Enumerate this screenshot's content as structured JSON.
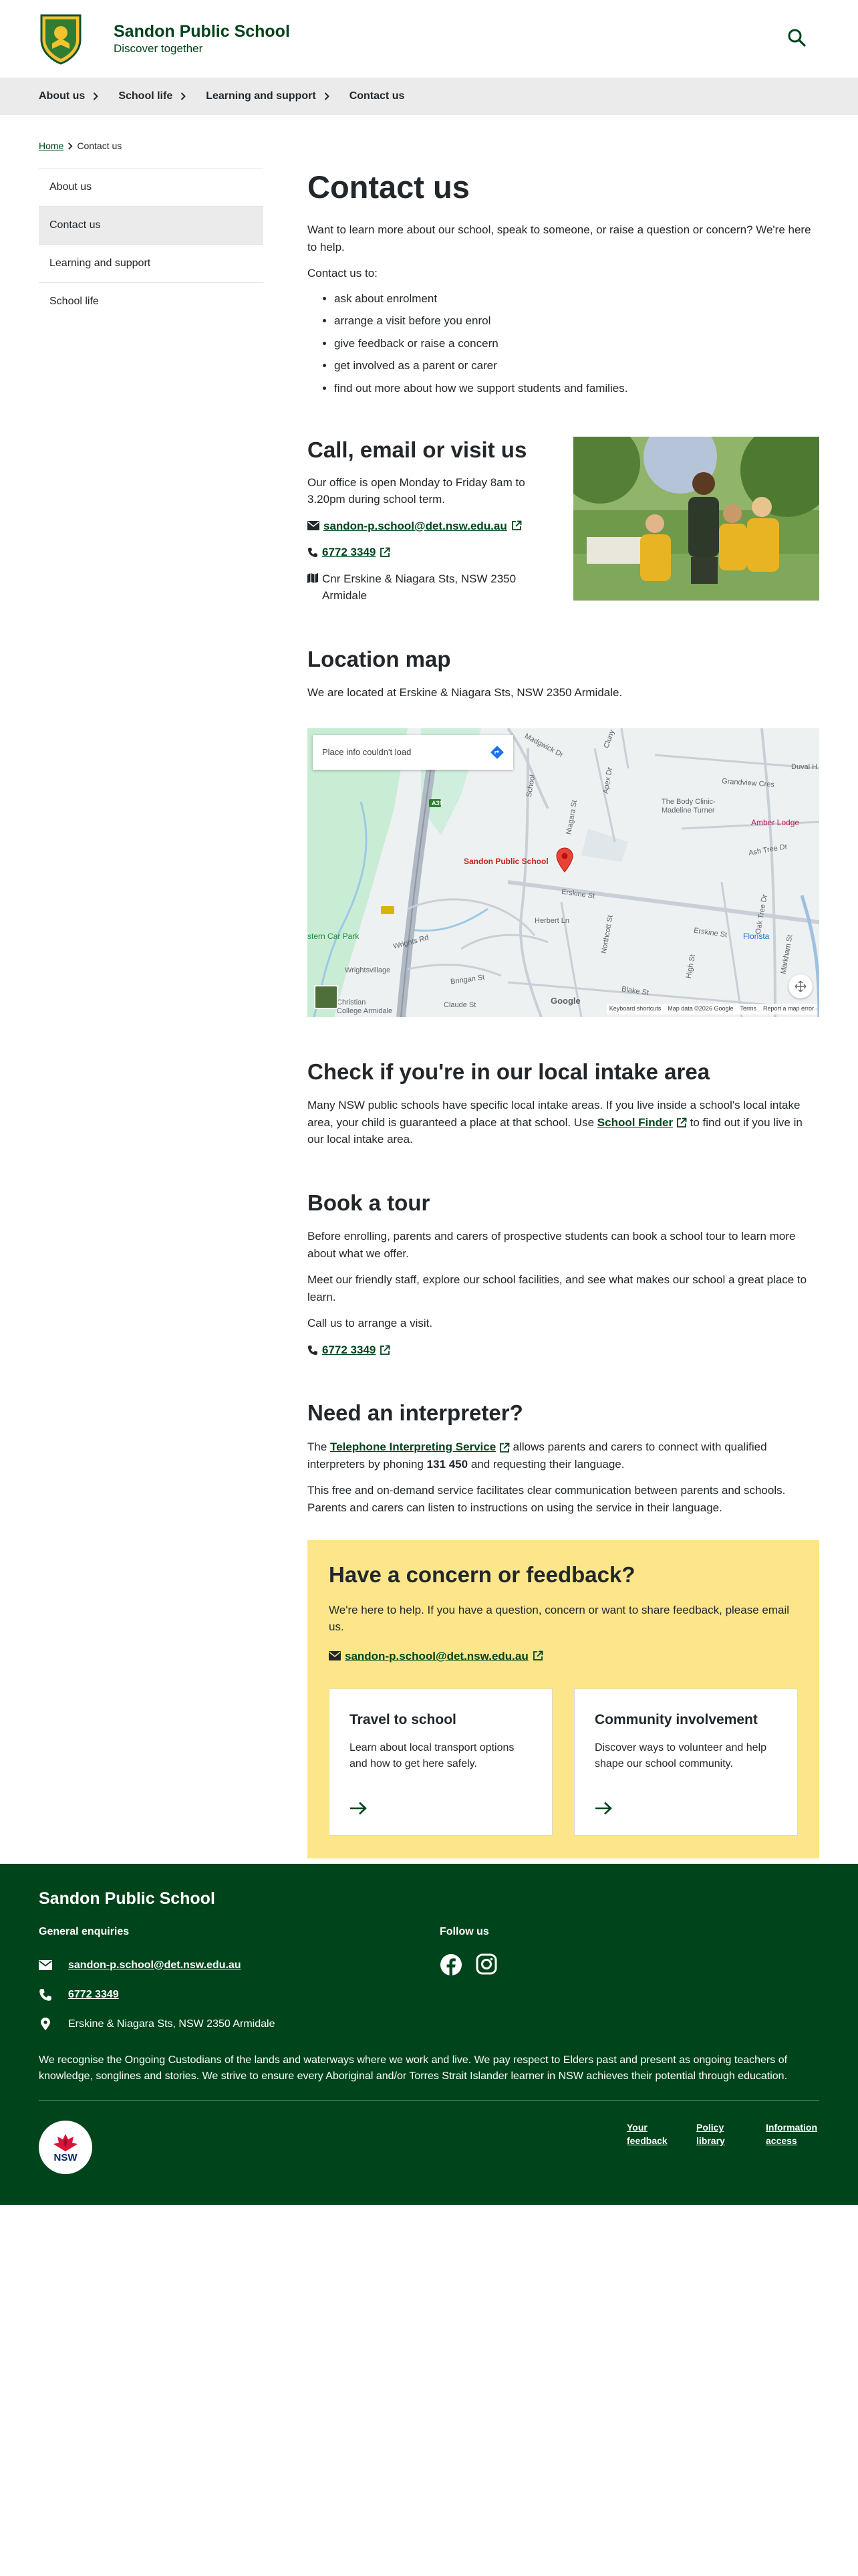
{
  "header": {
    "school_name": "Sandon Public School",
    "tagline": "Discover together",
    "search_icon": "search-icon"
  },
  "nav": [
    {
      "label": "About us",
      "has_chevron": true
    },
    {
      "label": "School life",
      "has_chevron": true
    },
    {
      "label": "Learning and support",
      "has_chevron": true
    },
    {
      "label": "Contact us",
      "has_chevron": false
    }
  ],
  "breadcrumb": {
    "home": "Home",
    "current": "Contact us"
  },
  "sidebar": [
    {
      "label": "About us",
      "active": false
    },
    {
      "label": "Contact us",
      "active": true
    },
    {
      "label": "Learning and support",
      "active": false
    },
    {
      "label": "School life",
      "active": false
    }
  ],
  "intro": {
    "title": "Contact us",
    "lead": "Want to learn more about our school, speak to someone, or raise a question or concern? We're here to help.",
    "list_intro": "Contact us to:",
    "items": [
      "ask about enrolment",
      "arrange a visit before you enrol",
      "give feedback or raise a concern",
      "get involved as a parent or carer",
      "find out more about how we support students and families."
    ]
  },
  "call": {
    "title": "Call, email or visit us",
    "hours": "Our office is open Monday to Friday 8am to 3.20pm during school term.",
    "email": "sandon-p.school@det.nsw.edu.au",
    "phone": "6772 3349",
    "address": "Cnr Erskine & Niagara Sts, NSW 2350 Armidale"
  },
  "location": {
    "title": "Location map",
    "text": "We are located at Erskine & Niagara Sts, NSW 2350 Armidale.",
    "map": {
      "notice": "Place info couldn't load",
      "pin_label": "Sandon Public School",
      "labels": {
        "madgwick": "Madgwick Dr",
        "niagara": "Niagara St",
        "erskine": "Erskine St",
        "herbert": "Herbert Ln",
        "northcott": "Northcott St",
        "wrights": "Wrights Rd",
        "bringan": "Bringan St",
        "claude": "Claude St",
        "high": "High St",
        "blake": "Blake St",
        "oak_tree": "Oak Tree Dr",
        "markham": "Markham St",
        "grandview": "Grandview Cres",
        "duval": "Duval H",
        "ash": "Ash Tree Dr",
        "cluny": "Cluny",
        "apex": "Apex Dr",
        "car_park": "stern Car Park",
        "school": "School",
        "wrights_village": "Wrightsvillage",
        "body_clinic": "The Body Clinic-\nMadeline Turner",
        "amber_lodge": "Amber Lodge",
        "florista": "Florista",
        "christian": "Christian\nCollege Armidale",
        "highway": "A39",
        "google": "Google"
      },
      "footer": [
        "Keyboard shortcuts",
        "Map data ©2026 Google",
        "Terms",
        "Report a map error"
      ]
    }
  },
  "intake": {
    "title": "Check if you're in our local intake area",
    "text_before": "Many NSW public schools have specific local intake areas. If you live inside a school's local intake area, your child is guaranteed a place at that school. Use",
    "link": "School Finder",
    "text_after": "to find out if you live in our local intake area."
  },
  "tour": {
    "title": "Book a tour",
    "p1": "Before enrolling, parents and carers of prospective students can book a school tour to learn more about what we offer.",
    "p2": "Meet our friendly staff, explore our school facilities, and see what makes our school a great place to learn.",
    "p3": "Call us to arrange a visit.",
    "phone": "6772 3349"
  },
  "interpreter": {
    "title": "Need an interpreter?",
    "text_before": "The",
    "link": "Telephone Interpreting Service",
    "text_mid": "allows parents and carers to connect with qualified interpreters by phoning",
    "number": "131 450",
    "text_after": "and requesting their language.",
    "p2": "This free and on-demand service facilitates clear communication between parents and schools. Parents and carers can listen to instructions on using the service in their language."
  },
  "concern": {
    "title": "Have a concern or feedback?",
    "text": "We're here to help. If you have a question, concern or want to share feedback, please email us.",
    "email": "sandon-p.school@det.nsw.edu.au",
    "cards": [
      {
        "title": "Travel to school",
        "text": "Learn about local transport options and how to get here safely."
      },
      {
        "title": "Community involvement",
        "text": "Discover ways to volunteer and help shape our school community."
      }
    ]
  },
  "footer": {
    "school_name": "Sandon Public School",
    "enquiries_heading": "General enquiries",
    "email": "sandon-p.school@det.nsw.edu.au",
    "phone": "6772 3349",
    "address": "Erskine & Niagara Sts, NSW 2350 Armidale",
    "follow_heading": "Follow us",
    "acknowledgement": "We recognise the Ongoing Custodians of the lands and waterways where we work and live. We pay respect to Elders past and present as ongoing teachers of knowledge, songlines and stories. We strive to ensure every Aboriginal and/or Torres Strait Islander learner in NSW achieves their potential through education.",
    "logo_text": "NSW",
    "links": [
      "Your feedback",
      "Policy library",
      "Information access"
    ]
  },
  "colors": {
    "brand_green": "#00441b",
    "concern_yellow": "#fde68a",
    "nav_grey": "#ebebeb",
    "map_pin_red": "#ea4335"
  }
}
